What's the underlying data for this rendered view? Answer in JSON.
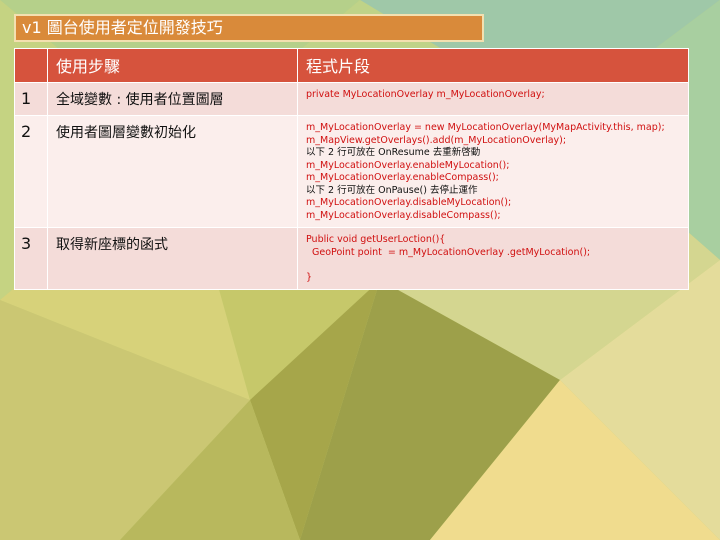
{
  "slide": {
    "title": "v1 圖台使用者定位開發技巧"
  },
  "table": {
    "headers": [
      "使用步驟",
      "程式片段"
    ],
    "rows": [
      {
        "num": "1",
        "step": "全域變數 : 使用者位置圖層",
        "code": [
          {
            "text": "private MyLocationOverlay m_MyLocationOverlay;",
            "color": "red"
          }
        ]
      },
      {
        "num": "2",
        "step": "使用者圖層變數初始化",
        "code": [
          {
            "text": "m_MyLocationOverlay = new MyLocationOverlay(MyMapActivity.this, map);",
            "color": "red"
          },
          {
            "text": "m_MapView.getOverlays().add(m_MyLocationOverlay);",
            "color": "red"
          },
          {
            "text": "以下 2 行可放在 OnResume 去重新啓動",
            "color": "black"
          },
          {
            "text": "m_MyLocationOverlay.enableMyLocation();",
            "color": "red"
          },
          {
            "text": "m_MyLocationOverlay.enableCompass();",
            "color": "red"
          },
          {
            "text": "以下 2 行可放在 OnPause() 去停止運作",
            "color": "black"
          },
          {
            "text": "m_MyLocationOverlay.disableMyLocation();",
            "color": "red"
          },
          {
            "text": "m_MyLocationOverlay.disableCompass();",
            "color": "red"
          }
        ]
      },
      {
        "num": "3",
        "step": "取得新座標的函式",
        "code": [
          {
            "text": "Public void getUserLoction(){",
            "color": "red"
          },
          {
            "text": "  GeoPoint point  = m_MyLocationOverlay .getMyLocation();",
            "color": "red"
          },
          {
            "text": " ",
            "color": "red"
          },
          {
            "text": "}",
            "color": "red"
          }
        ]
      }
    ]
  }
}
